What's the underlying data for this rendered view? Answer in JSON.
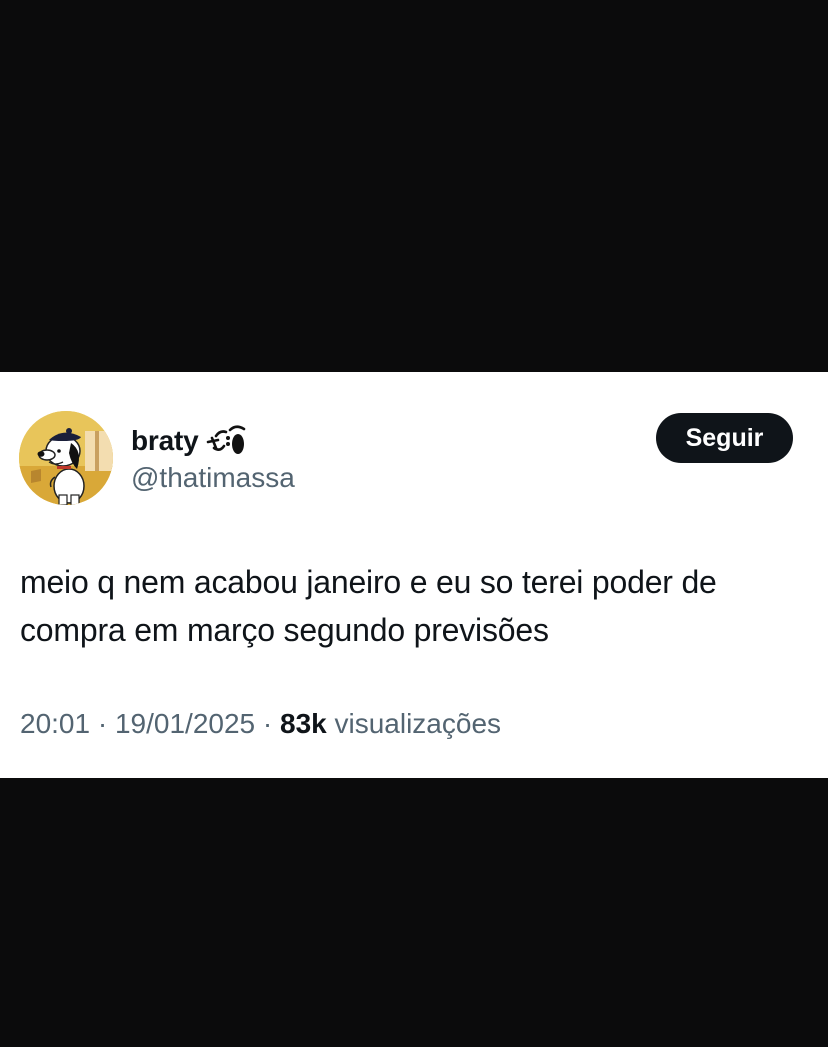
{
  "tweet": {
    "author": {
      "display_name": "braty",
      "name_emoji_icon": "smiling-face-with-tear-icon",
      "handle": "@thatimassa",
      "avatar_icon": "snoopy-avatar-icon"
    },
    "follow_label": "Seguir",
    "text": "meio q nem acabou janeiro e eu so terei poder de compra em março segundo previsões",
    "time": "20:01",
    "separator": "·",
    "date": "19/01/2025",
    "views_count": "83k",
    "views_label": "visualizações"
  },
  "colors": {
    "background": "#0b0b0c",
    "card": "#ffffff",
    "text_primary": "#0f1419",
    "text_secondary": "#536471",
    "button_bg": "#0f1419"
  }
}
